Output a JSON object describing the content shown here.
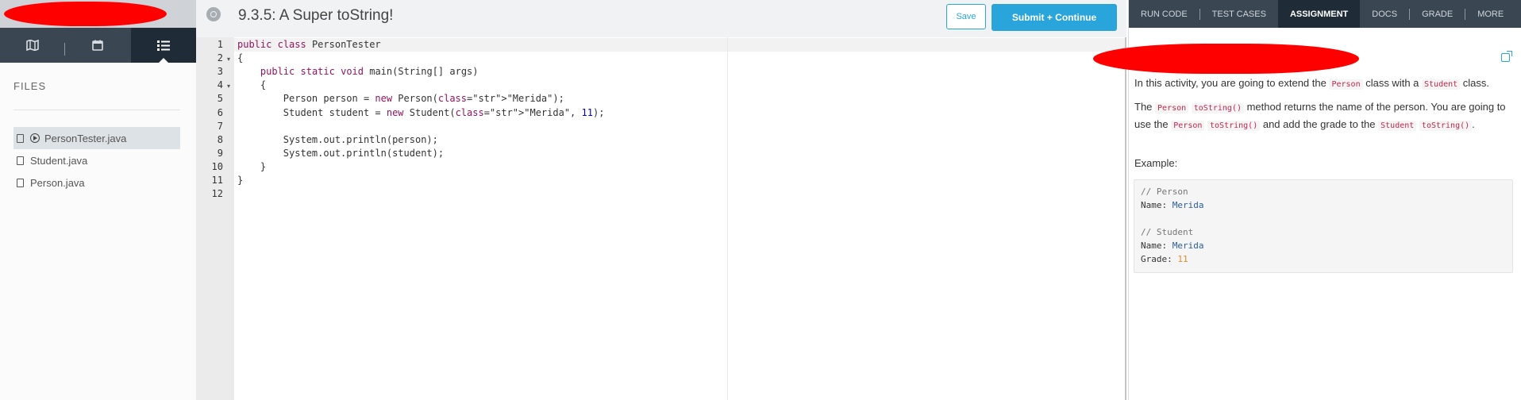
{
  "sidebar": {
    "tabs": [
      {
        "name": "map-icon"
      },
      {
        "name": "calendar-icon"
      },
      {
        "name": "list-icon"
      }
    ],
    "files_label": "FILES",
    "files": [
      {
        "label": "PersonTester.java",
        "active": true
      },
      {
        "label": "Student.java",
        "active": false
      },
      {
        "label": "Person.java",
        "active": false
      }
    ]
  },
  "header": {
    "title": "9.3.5: A Super toString!",
    "save_label": "Save",
    "submit_label": "Submit + Continue"
  },
  "editor": {
    "line_numbers": [
      "1",
      "2",
      "3",
      "4",
      "5",
      "6",
      "7",
      "8",
      "9",
      "10",
      "11",
      "12"
    ],
    "lines": [
      "public class PersonTester",
      "{",
      "    public static void main(String[] args)",
      "    {",
      "        Person person = new Person(\"Merida\");",
      "        Student student = new Student(\"Merida\", 11);",
      "",
      "        System.out.println(person);",
      "        System.out.println(student);",
      "    }",
      "}",
      ""
    ]
  },
  "right_tabs": [
    "RUN CODE",
    "TEST CASES",
    "ASSIGNMENT",
    "DOCS",
    "GRADE",
    "MORE"
  ],
  "assignment": {
    "p1": {
      "a": "In this activity, you are going to extend the ",
      "c1": "Person",
      "b": " class with a ",
      "c2": "Student",
      "d": " class."
    },
    "p2": {
      "a": "The ",
      "c1": "Person",
      "c2": "toString()",
      "b": " method returns the name of the person. You are going to use the ",
      "c3": "Person",
      "c4": "toString()",
      "d": " and add the grade to the ",
      "c5": "Student",
      "c6": "toString()",
      "e": "."
    },
    "example_label": "Example:",
    "example": {
      "c1": "// Person",
      "k1": "Name:",
      "v1": "Merida",
      "c2": "// Student",
      "k2": "Name:",
      "v2": "Merida",
      "k3": "Grade:",
      "v3": "11"
    }
  },
  "colors": {
    "accent": "#2aa5dc",
    "dark_nav": "#3a4652",
    "active_nav": "#1f2c37",
    "code_chip": "#c7254e"
  }
}
